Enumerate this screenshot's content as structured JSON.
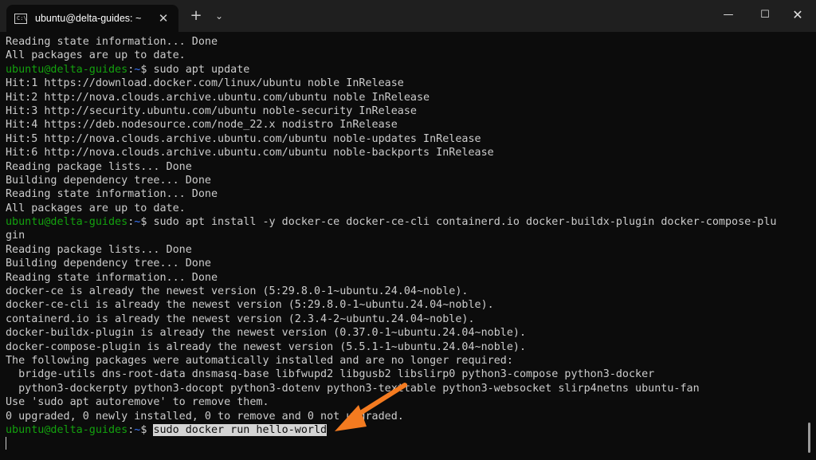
{
  "window": {
    "tab_icon": "C:\\",
    "tab_title": "ubuntu@delta-guides: ~",
    "tab_close": "✕",
    "new_tab": "+",
    "dropdown": "⌄",
    "minimize": "—",
    "maximize": "☐",
    "close": "✕"
  },
  "prompt": {
    "user_host": "ubuntu@delta-guides",
    "sep": ":",
    "path": "~",
    "symbol": "$ "
  },
  "lines": [
    {
      "text": "Reading state information... Done"
    },
    {
      "text": "All packages are up to date."
    },
    {
      "prompt": true,
      "cmd": "sudo apt update"
    },
    {
      "text": "Hit:1 https://download.docker.com/linux/ubuntu noble InRelease"
    },
    {
      "text": "Hit:2 http://nova.clouds.archive.ubuntu.com/ubuntu noble InRelease"
    },
    {
      "text": "Hit:3 http://security.ubuntu.com/ubuntu noble-security InRelease"
    },
    {
      "text": "Hit:4 https://deb.nodesource.com/node_22.x nodistro InRelease"
    },
    {
      "text": "Hit:5 http://nova.clouds.archive.ubuntu.com/ubuntu noble-updates InRelease"
    },
    {
      "text": "Hit:6 http://nova.clouds.archive.ubuntu.com/ubuntu noble-backports InRelease"
    },
    {
      "text": "Reading package lists... Done"
    },
    {
      "text": "Building dependency tree... Done"
    },
    {
      "text": "Reading state information... Done"
    },
    {
      "text": "All packages are up to date."
    },
    {
      "prompt": true,
      "cmd": "sudo apt install -y docker-ce docker-ce-cli containerd.io docker-buildx-plugin docker-compose-plu"
    },
    {
      "text": "gin"
    },
    {
      "text": "Reading package lists... Done"
    },
    {
      "text": "Building dependency tree... Done"
    },
    {
      "text": "Reading state information... Done"
    },
    {
      "text": "docker-ce is already the newest version (5:29.8.0-1~ubuntu.24.04~noble)."
    },
    {
      "text": "docker-ce-cli is already the newest version (5:29.8.0-1~ubuntu.24.04~noble)."
    },
    {
      "text": "containerd.io is already the newest version (2.3.4-2~ubuntu.24.04~noble)."
    },
    {
      "text": "docker-buildx-plugin is already the newest version (0.37.0-1~ubuntu.24.04~noble)."
    },
    {
      "text": "docker-compose-plugin is already the newest version (5.5.1-1~ubuntu.24.04~noble)."
    },
    {
      "text": "The following packages were automatically installed and are no longer required:"
    },
    {
      "text": "  bridge-utils dns-root-data dnsmasq-base libfwupd2 libgusb2 libslirp0 python3-compose python3-docker"
    },
    {
      "text": "  python3-dockerpty python3-docopt python3-dotenv python3-texttable python3-websocket slirp4netns ubuntu-fan"
    },
    {
      "text": "Use 'sudo apt autoremove' to remove them."
    },
    {
      "text": "0 upgraded, 0 newly installed, 0 to remove and 0 not upgraded."
    },
    {
      "prompt": true,
      "cmd": "sudo docker run hello-world",
      "selected": true
    },
    {
      "cursor": true
    }
  ],
  "colors": {
    "prompt_user": "#13a10e",
    "prompt_path": "#3b78ff",
    "arrow": "#f47b20",
    "background": "#0c0c0c",
    "foreground": "#cccccc"
  },
  "icons": [
    "terminal-app-icon",
    "close-icon",
    "plus-icon",
    "chevron-down-icon",
    "minimize-icon",
    "maximize-icon",
    "arrow-annotation"
  ]
}
